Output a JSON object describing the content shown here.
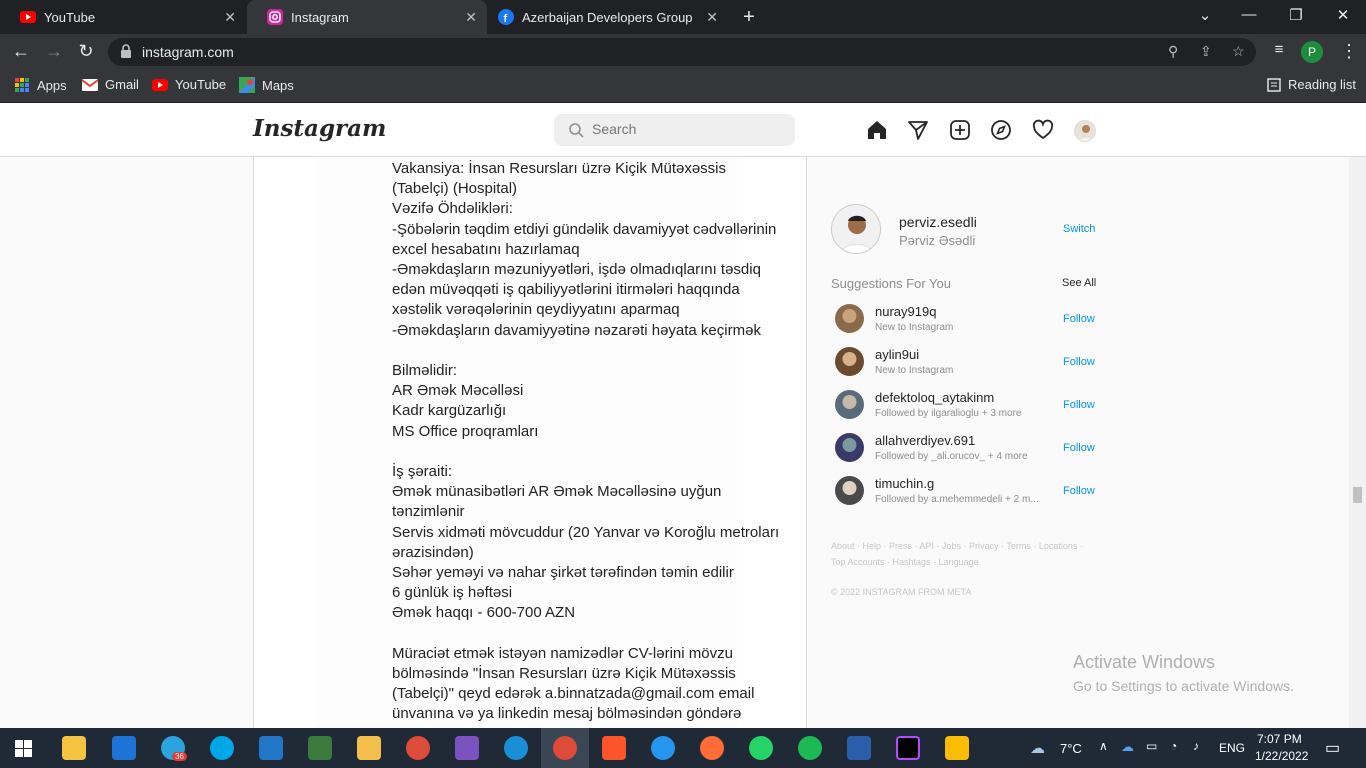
{
  "browser": {
    "tabs": [
      {
        "title": "YouTube",
        "favicon": "youtube-icon"
      },
      {
        "title": "Instagram",
        "favicon": "instagram-icon"
      },
      {
        "title": "Azerbaijan Developers Group | Fa",
        "favicon": "facebook-icon"
      }
    ],
    "url": "instagram.com",
    "profile_letter": "P",
    "bookmarks": [
      {
        "label": "Apps",
        "icon": "apps-grid-icon"
      },
      {
        "label": "Gmail",
        "icon": "gmail-icon"
      },
      {
        "label": "YouTube",
        "icon": "youtube-icon"
      },
      {
        "label": "Maps",
        "icon": "maps-icon"
      }
    ],
    "reading_list": "Reading list"
  },
  "instagram": {
    "logo": "Instagram",
    "search_placeholder": "Search",
    "post_lines": [
      " Vakansiya: İnsan Resursları üzrə Kiçik Mütəxəssis",
      "(Tabelçi) (Hospital)",
      " Vəzifə Öhdəlikləri:",
      "-Şöbələrin təqdim etdiyi gündəlik davamiyyət cədvəllərinin",
      "excel hesabatını hazırlamaq",
      "-Əməkdaşların məzuniyyətləri, işdə olmadıqlarını təsdiq",
      "edən müvəqqəti iş qabiliyyətlərini itirmələri haqqında",
      "xəstəlik vərəqələrinin qeydiyyatını aparmaq",
      "-Əməkdaşların davamiyyətinə nəzarəti həyata keçirmək",
      "",
      "Bilməlidir:",
      "AR Əmək Məcəlləsi",
      "Kadr kargüzarlığı",
      "MS Office proqramları",
      "",
      "İş şəraiti:",
      "Əmək münasibətləri AR Əmək Məcəlləsinə uyğun",
      "tənzimlənir",
      "Servis xidməti mövcuddur (20 Yanvar və Koroğlu metroları",
      "ərazisindən)",
      "Səhər yeməyi və nahar şirkət tərəfindən təmin edilir",
      "6 günlük iş həftəsi",
      "Əmək haqqı - 600-700 AZN",
      "",
      "Müraciət etmək istəyən namizədlər CV-lərini mövzu",
      "bölməsində \"İnsan Resursları üzrə Kiçik Mütəxəssis",
      "(Tabelçi)\" qeyd edərək a.binnatzada@gmail.com email",
      "ünvanına və ya linkedin mesaj bölməsindən göndərə"
    ],
    "me": {
      "username": "perviz.esedli",
      "fullname": "Pərviz Əsədli",
      "action": "Switch"
    },
    "suggestions_title": "Suggestions For You",
    "see_all": "See All",
    "suggestions": [
      {
        "username": "nuray919q",
        "subtitle": "New to Instagram",
        "action": "Follow"
      },
      {
        "username": "aylin9ui",
        "subtitle": "New to Instagram",
        "action": "Follow"
      },
      {
        "username": "defektoloq_aytakinm",
        "subtitle": "Followed by ilgaralioglu + 3 more",
        "action": "Follow"
      },
      {
        "username": "allahverdiyev.691",
        "subtitle": "Followed by _ali.orucov_ + 4 more",
        "action": "Follow"
      },
      {
        "username": "timuchin.g",
        "subtitle": "Followed by a.mehemmedeli + 2 m...",
        "action": "Follow"
      }
    ],
    "footer_links_1": "About · Help · Press · API · Jobs · Privacy · Terms · Locations ·",
    "footer_links_2": "Top Accounts · Hashtags · Language",
    "copyright": "© 2022 INSTAGRAM FROM META"
  },
  "watermark": {
    "title": "Activate Windows",
    "subtitle": "Go to Settings to activate Windows."
  },
  "taskbar": {
    "telegram_badge": "36",
    "weather": "7°C",
    "language": "ENG",
    "time": "7:07 PM",
    "date": "1/22/2022"
  }
}
